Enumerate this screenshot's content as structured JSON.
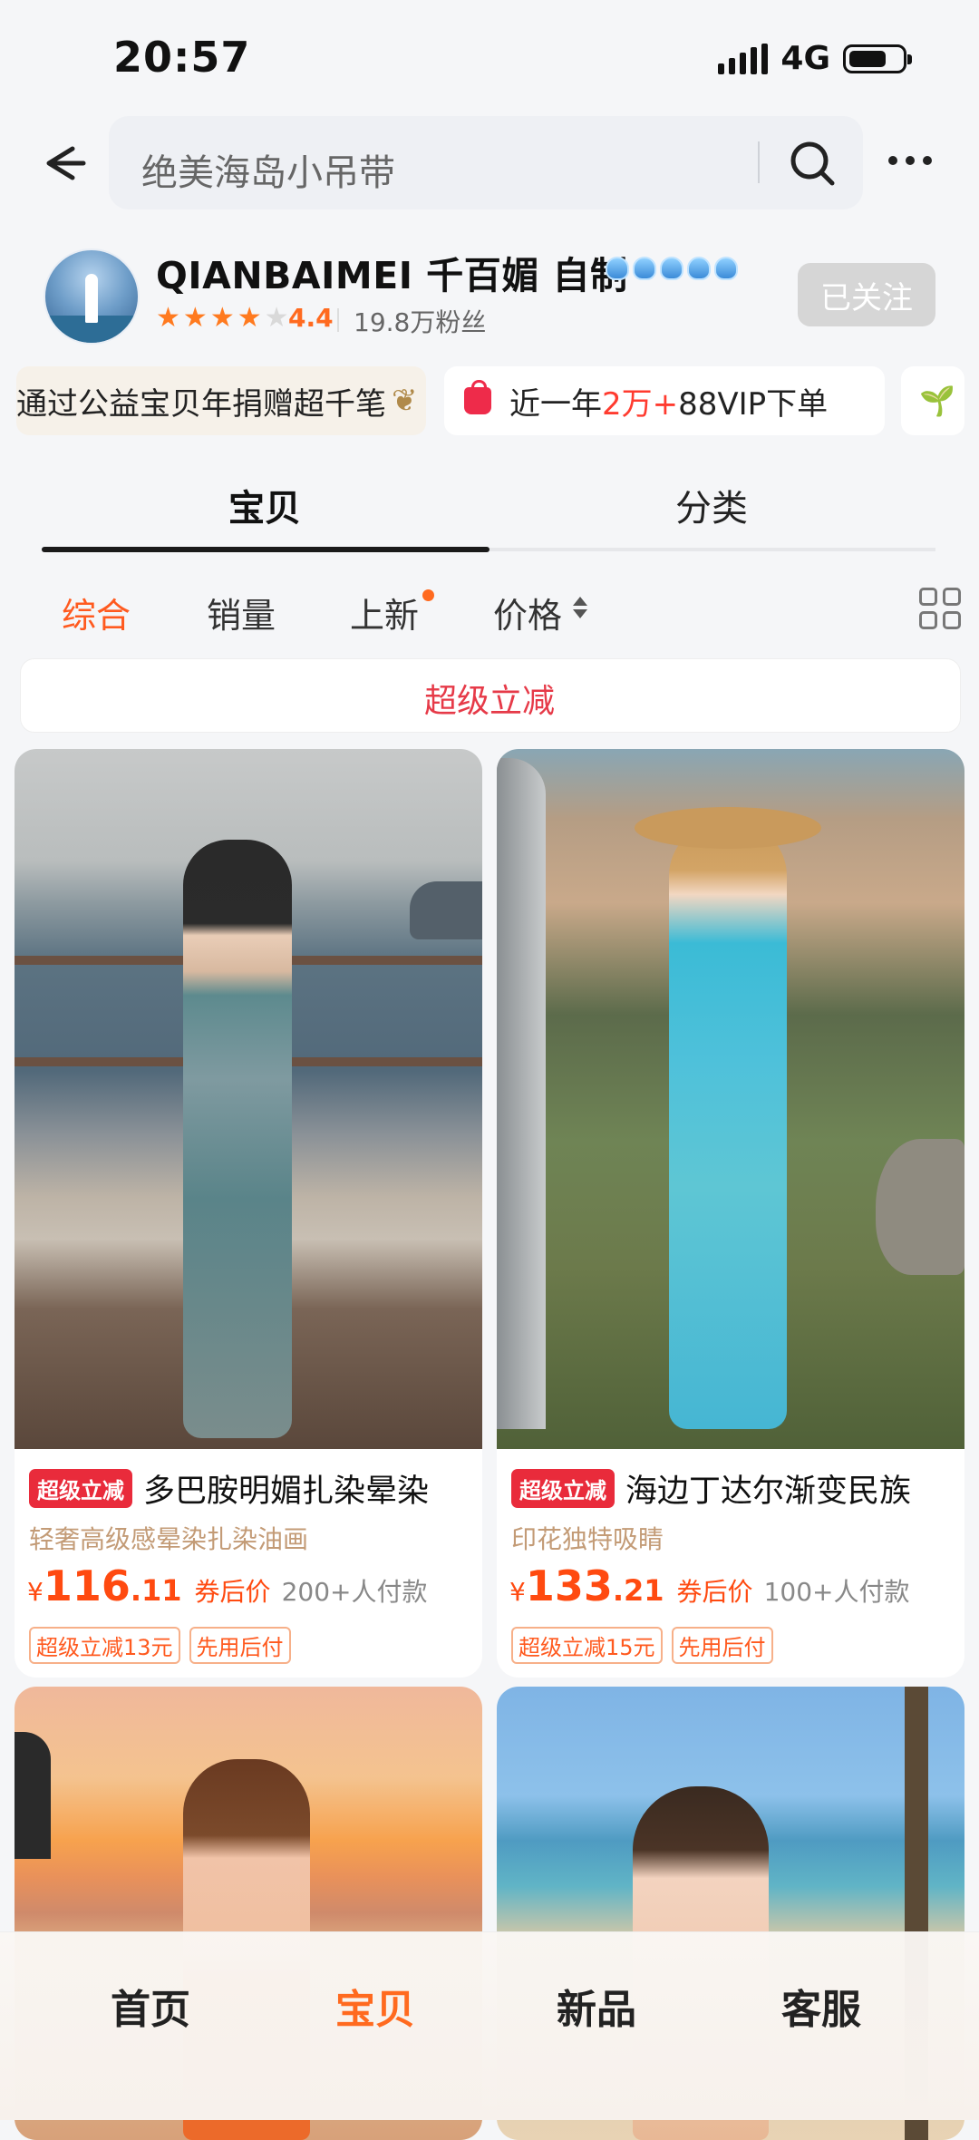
{
  "status_bar": {
    "time": "20:57",
    "network": "4G"
  },
  "search": {
    "query": "绝美海岛小吊带"
  },
  "shop": {
    "name": "QIANBAIMEI 千百媚 自制",
    "rating": "4.4",
    "stars_filled": 4,
    "stars_total": 5,
    "followers": "19.8万粉丝",
    "follow_label": "已关注"
  },
  "badges": {
    "charity": "通过公益宝贝年捐赠超千笔",
    "vip_prefix": "近一年",
    "vip_highlight": "2万+",
    "vip_suffix": "88VIP下单"
  },
  "tabs": [
    {
      "label": "宝贝"
    },
    {
      "label": "分类"
    }
  ],
  "sort": [
    {
      "label": "综合"
    },
    {
      "label": "销量"
    },
    {
      "label": "上新"
    },
    {
      "label": "价格"
    }
  ],
  "promo_banner": "超级立减",
  "products": [
    {
      "tag": "超级立减",
      "title": "多巴胺明媚扎染晕染",
      "subtitle": "轻奢高级感晕染扎染油画",
      "currency": "¥",
      "price_int": "116",
      "price_dec": ".11",
      "after_coupon": "券后价",
      "paid": "200+人付款",
      "tags": [
        "超级立减13元",
        "先用后付"
      ]
    },
    {
      "tag": "超级立减",
      "title": "海边丁达尔渐变民族",
      "subtitle": "印花独特吸睛",
      "currency": "¥",
      "price_int": "133",
      "price_dec": ".21",
      "after_coupon": "券后价",
      "paid": "100+人付款",
      "tags": [
        "超级立减15元",
        "先用后付"
      ]
    }
  ],
  "bottom_nav": [
    {
      "label": "首页"
    },
    {
      "label": "宝贝"
    },
    {
      "label": "新品"
    },
    {
      "label": "客服"
    }
  ],
  "colors": {
    "accent": "#ff6a1f",
    "promo_red": "#e92b3b"
  },
  "icons": [
    "back-arrow-icon",
    "search-icon",
    "more-icon",
    "crown-icon",
    "shopping-bag-icon",
    "sprout-icon",
    "sort-arrows-icon",
    "grid-view-icon"
  ]
}
